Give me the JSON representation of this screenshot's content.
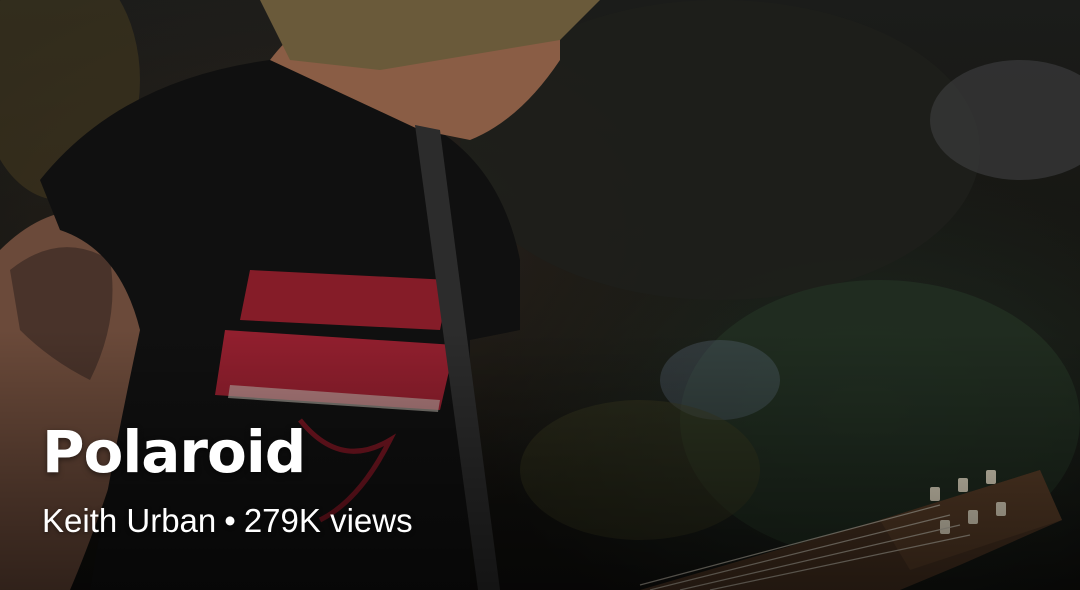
{
  "video": {
    "title": "Polaroid",
    "artist": "Keith Urban",
    "separator": "•",
    "views": "279K views"
  }
}
